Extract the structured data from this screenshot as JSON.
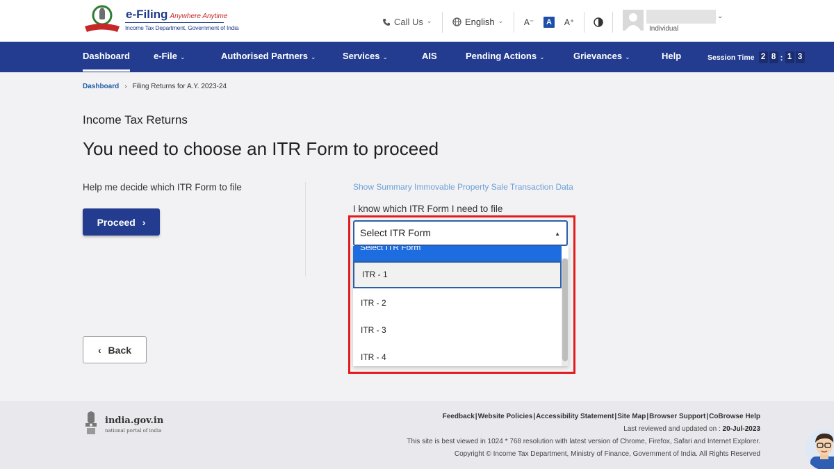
{
  "header": {
    "logo_title": "e-Filing",
    "logo_tagline": "Anywhere Anytime",
    "logo_subtitle": "Income Tax Department, Government of India",
    "call_us": "Call Us",
    "language": "English",
    "font_decrease": "A⁻",
    "font_normal": "A",
    "font_increase": "A⁺",
    "user_role": "Individual"
  },
  "nav": {
    "items": [
      {
        "label": "Dashboard"
      },
      {
        "label": "e-File"
      },
      {
        "label": "Authorised Partners"
      },
      {
        "label": "Services"
      },
      {
        "label": "AIS"
      },
      {
        "label": "Pending Actions"
      },
      {
        "label": "Grievances"
      },
      {
        "label": "Help"
      }
    ],
    "session_label": "Session Time",
    "session_digits": [
      "2",
      "8",
      "1",
      "3"
    ]
  },
  "breadcrumb": {
    "home": "Dashboard",
    "current": "Filing Returns for A.Y. 2023-24"
  },
  "main": {
    "section_label": "Income Tax Returns",
    "title": "You need to choose an ITR Form to proceed",
    "help_text": "Help me decide which ITR Form to file",
    "proceed_label": "Proceed",
    "summary_link": "Show Summary Immovable Property Sale Transaction Data",
    "know_label": "I know which ITR Form I need to file",
    "select_value": "Select ITR Form",
    "dropdown_options": [
      "Select ITR Form",
      "ITR - 1",
      "ITR - 2",
      "ITR - 3",
      "ITR - 4"
    ],
    "back_label": "Back"
  },
  "footer": {
    "gov_name": "india.gov.in",
    "gov_sub": "national portal of india",
    "links": [
      "Feedback",
      "Website Policies",
      "Accessibility Statement",
      "Site Map",
      "Browser Support",
      "CoBrowse Help"
    ],
    "updated_label": "Last reviewed and updated on :",
    "updated_date": "20-Jul-2023",
    "resolution_note": "This site is best viewed in 1024 * 768 resolution with latest version of Chrome, Firefox, Safari and Internet Explorer.",
    "copyright": "Copyright © Income Tax Department, Ministry of Finance, Government of India. All Rights Reserved"
  },
  "colors": {
    "nav_bg": "#233c8f",
    "highlight": "#e31b1b",
    "dropdown_selected": "#1d6ce0",
    "link": "#1d5fa8"
  },
  "icons": [
    "phone-icon",
    "globe-icon",
    "contrast-icon",
    "user-avatar-icon",
    "chevron-down-icon",
    "chevron-right-icon",
    "chevron-left-icon",
    "caret-up-icon",
    "national-emblem-icon",
    "chatbot-icon"
  ]
}
